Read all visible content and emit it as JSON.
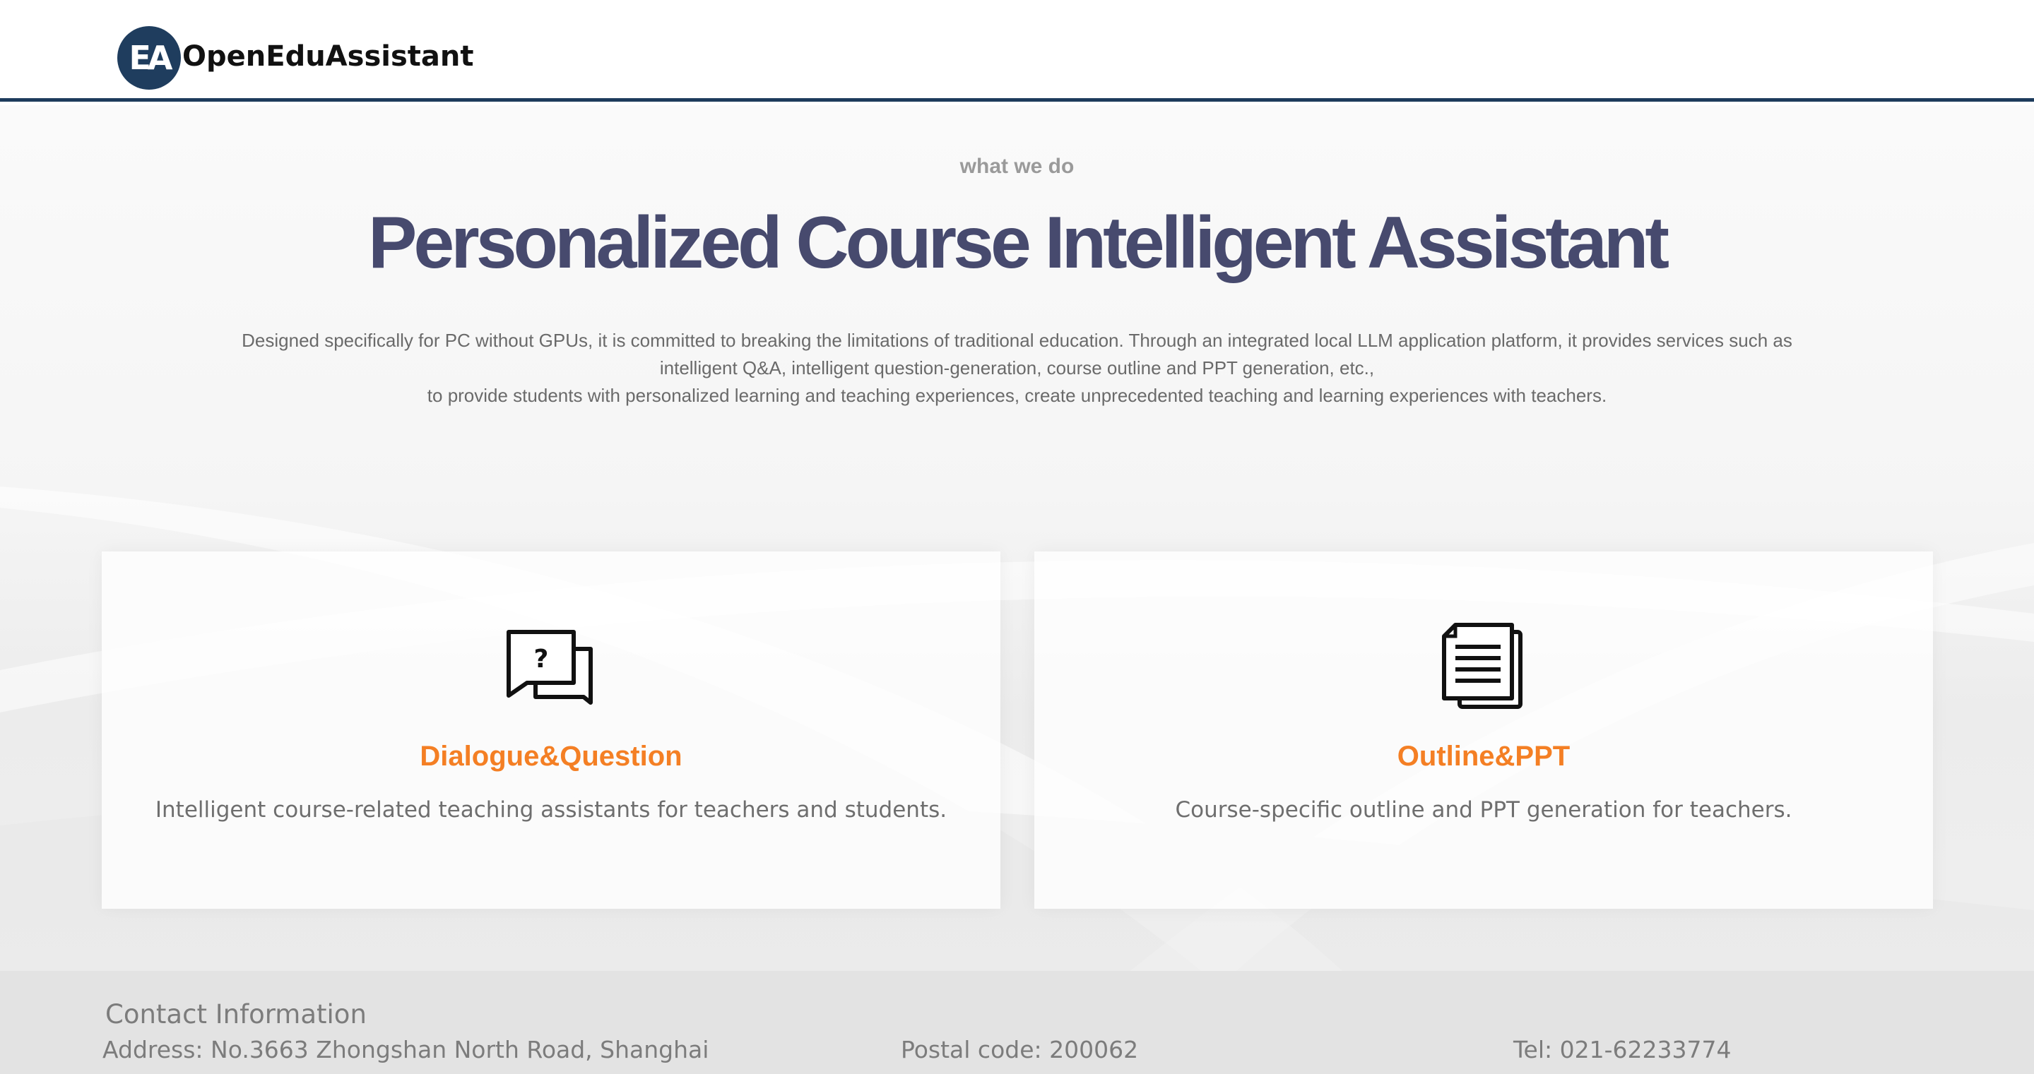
{
  "header": {
    "logo_mark": "EA",
    "brand": "OpenEduAssistant"
  },
  "hero": {
    "eyebrow": "what we do",
    "title": "Personalized Course Intelligent Assistant",
    "description_lines": [
      "Designed specifically for PC without GPUs, it is committed to breaking the limitations of traditional education. Through an integrated local LLM application platform, it provides services such as",
      "intelligent Q&A, intelligent question-generation, course outline and PPT generation, etc.,",
      "to provide students with personalized learning and teaching experiences, create unprecedented teaching and learning experiences with teachers."
    ]
  },
  "features": [
    {
      "icon": "chat-question-icon",
      "title": "Dialogue&Question",
      "text": "Intelligent course-related teaching assistants for teachers and students."
    },
    {
      "icon": "document-stack-icon",
      "title": "Outline&PPT",
      "text": "Course-specific outline and PPT generation for teachers."
    }
  ],
  "footer": {
    "title": "Contact Information",
    "address": "Address: No.3663 Zhongshan North Road, Shanghai",
    "postal": "Postal code: 200062",
    "tel": "Tel: 021-62233774"
  },
  "colors": {
    "brand_navy": "#1f3d5e",
    "title": "#474a6e",
    "accent_orange": "#f47f24"
  }
}
